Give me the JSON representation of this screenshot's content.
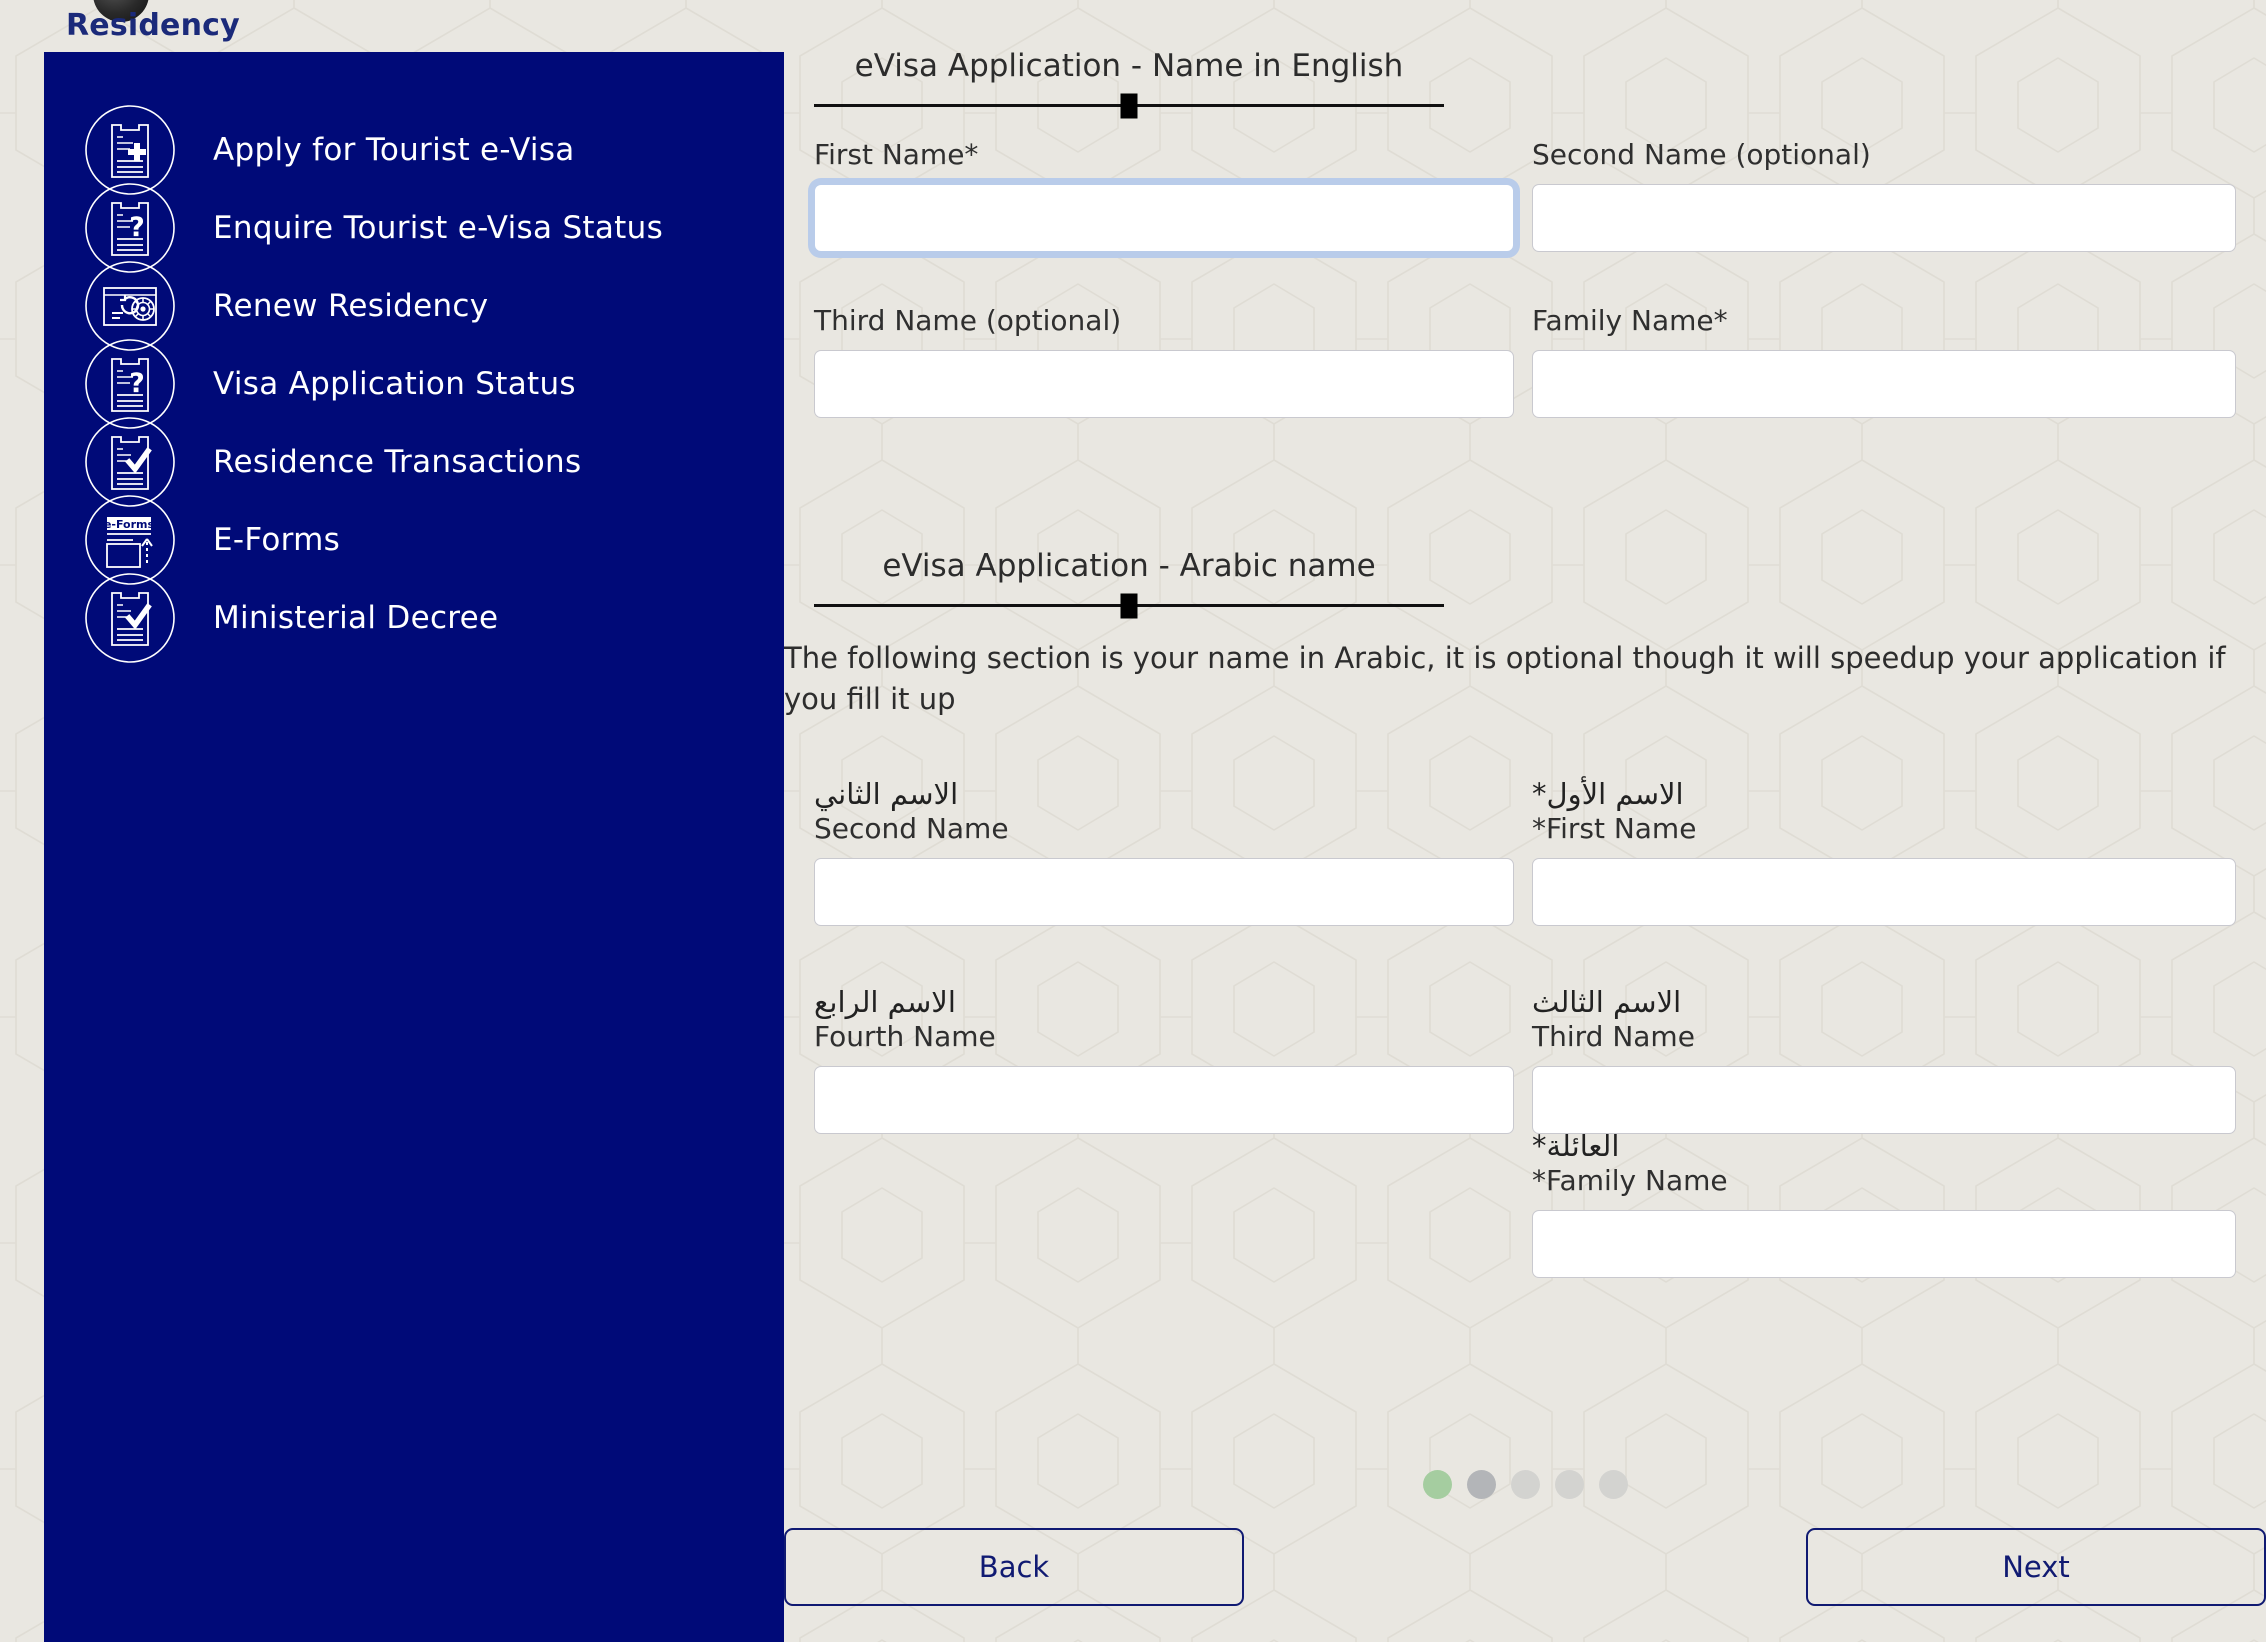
{
  "brand": {
    "logo_icon": "emblem-logo",
    "title": "Residency"
  },
  "colors": {
    "sidebar_navy": "#000a78",
    "page_beige": "#e9e7e1",
    "brand_navy": "#101a72",
    "focus_ring_blue": "#b9ccea",
    "dot_active_green": "#a5cda0",
    "dot_next_gray": "#b3b5b8",
    "dot_idle_gray": "#d3d3d0",
    "input_white": "#ffffff",
    "input_border": "#c9c9cf"
  },
  "sidebar": {
    "items": [
      {
        "label": "Apply for Tourist e-Visa",
        "icon": "document-plus-icon"
      },
      {
        "label": "Enquire Tourist e-Visa Status",
        "icon": "document-question-icon"
      },
      {
        "label": "Renew Residency",
        "icon": "id-card-renew-icon"
      },
      {
        "label": "Visa Application Status",
        "icon": "document-question-icon"
      },
      {
        "label": "Residence Transactions",
        "icon": "document-check-icon"
      },
      {
        "label": "E-Forms",
        "icon": "e-forms-upload-icon"
      },
      {
        "label": "Ministerial Decree",
        "icon": "document-check-icon"
      }
    ]
  },
  "form": {
    "english_section": {
      "title": "eVisa Application - Name in English",
      "fields": [
        {
          "label": "First Name*",
          "value": "",
          "placeholder": "",
          "focused": true
        },
        {
          "label": "Second Name (optional)",
          "value": "",
          "placeholder": "",
          "focused": false
        },
        {
          "label": "Third Name (optional)",
          "value": "",
          "placeholder": "",
          "focused": false
        },
        {
          "label": "Family Name*",
          "value": "",
          "placeholder": "",
          "focused": false
        }
      ]
    },
    "arabic_section": {
      "title": "eVisa Application - Arabic name",
      "note": "The following section is your name in Arabic, it is optional though it will speedup your application if you fill it up",
      "fields": [
        {
          "label_ar": "الاسم الأول*",
          "label_en": "*First Name",
          "value": "",
          "placeholder": ""
        },
        {
          "label_ar": "الاسم الثاني",
          "label_en": "Second Name",
          "value": "",
          "placeholder": ""
        },
        {
          "label_ar": "الاسم الثالث",
          "label_en": "Third Name",
          "value": "",
          "placeholder": ""
        },
        {
          "label_ar": "الاسم الرابع",
          "label_en": "Fourth Name",
          "value": "",
          "placeholder": ""
        },
        {
          "label_ar": "العائلة*",
          "label_en": "*Family Name",
          "value": "",
          "placeholder": ""
        }
      ]
    }
  },
  "pagination": {
    "total": 5,
    "current": 1,
    "states": [
      "active",
      "next",
      "idle",
      "idle",
      "idle"
    ]
  },
  "footer": {
    "back_label": "Back",
    "next_label": "Next"
  }
}
